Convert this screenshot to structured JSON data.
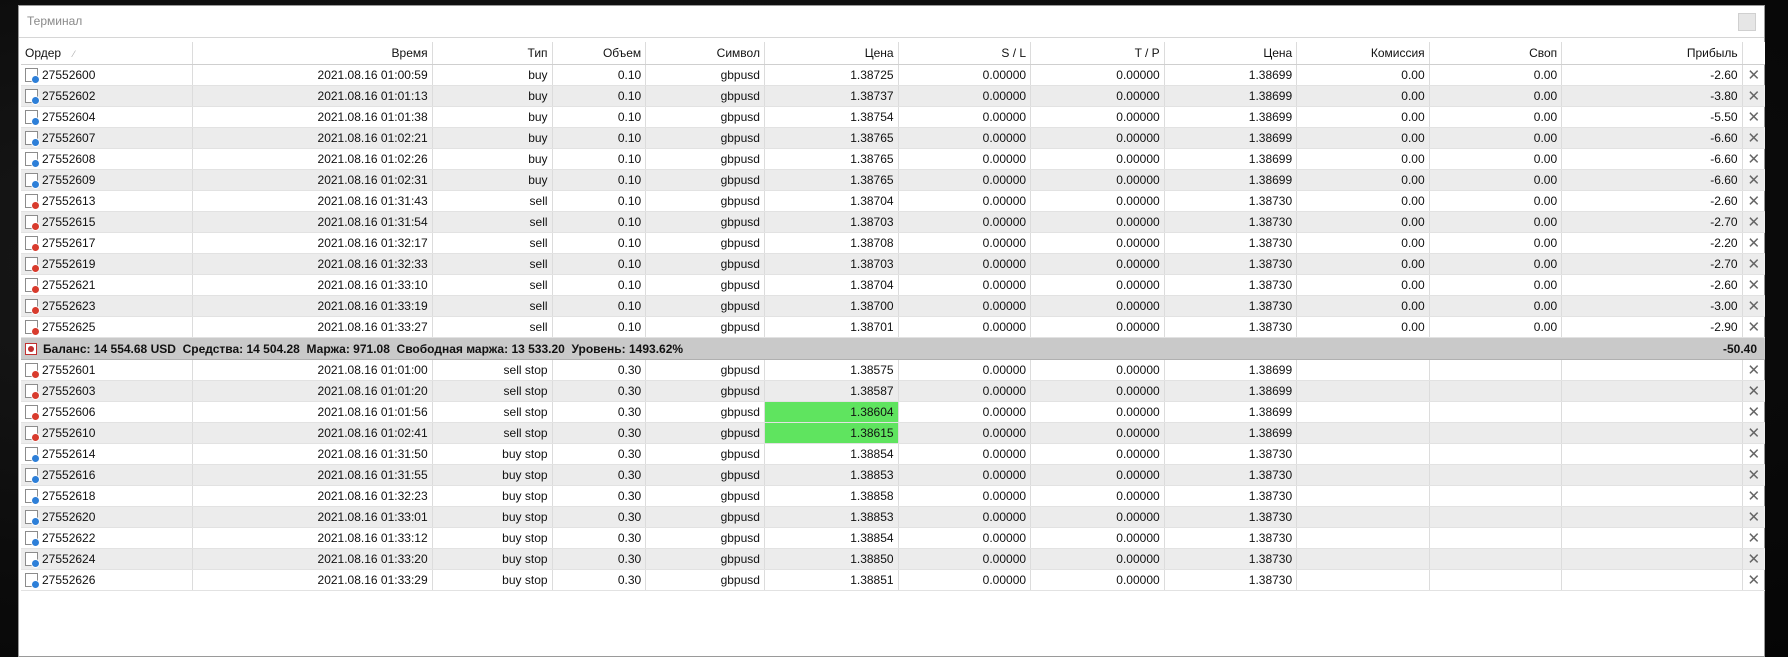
{
  "window": {
    "title": "Терминал"
  },
  "columns": [
    "Ордер",
    "Время",
    "Тип",
    "Объем",
    "Символ",
    "Цена",
    "S / L",
    "T / P",
    "Цена",
    "Комиссия",
    "Своп",
    "Прибыль"
  ],
  "sort_indicator": "⁄",
  "positions": [
    {
      "order": "27552600",
      "time": "2021.08.16 01:00:59",
      "type": "buy",
      "volume": "0.10",
      "symbol": "gbpusd",
      "price": "1.38725",
      "sl": "0.00000",
      "tp": "0.00000",
      "cur_price": "1.38699",
      "commission": "0.00",
      "swap": "0.00",
      "profit": "-2.60"
    },
    {
      "order": "27552602",
      "time": "2021.08.16 01:01:13",
      "type": "buy",
      "volume": "0.10",
      "symbol": "gbpusd",
      "price": "1.38737",
      "sl": "0.00000",
      "tp": "0.00000",
      "cur_price": "1.38699",
      "commission": "0.00",
      "swap": "0.00",
      "profit": "-3.80"
    },
    {
      "order": "27552604",
      "time": "2021.08.16 01:01:38",
      "type": "buy",
      "volume": "0.10",
      "symbol": "gbpusd",
      "price": "1.38754",
      "sl": "0.00000",
      "tp": "0.00000",
      "cur_price": "1.38699",
      "commission": "0.00",
      "swap": "0.00",
      "profit": "-5.50"
    },
    {
      "order": "27552607",
      "time": "2021.08.16 01:02:21",
      "type": "buy",
      "volume": "0.10",
      "symbol": "gbpusd",
      "price": "1.38765",
      "sl": "0.00000",
      "tp": "0.00000",
      "cur_price": "1.38699",
      "commission": "0.00",
      "swap": "0.00",
      "profit": "-6.60"
    },
    {
      "order": "27552608",
      "time": "2021.08.16 01:02:26",
      "type": "buy",
      "volume": "0.10",
      "symbol": "gbpusd",
      "price": "1.38765",
      "sl": "0.00000",
      "tp": "0.00000",
      "cur_price": "1.38699",
      "commission": "0.00",
      "swap": "0.00",
      "profit": "-6.60"
    },
    {
      "order": "27552609",
      "time": "2021.08.16 01:02:31",
      "type": "buy",
      "volume": "0.10",
      "symbol": "gbpusd",
      "price": "1.38765",
      "sl": "0.00000",
      "tp": "0.00000",
      "cur_price": "1.38699",
      "commission": "0.00",
      "swap": "0.00",
      "profit": "-6.60"
    },
    {
      "order": "27552613",
      "time": "2021.08.16 01:31:43",
      "type": "sell",
      "volume": "0.10",
      "symbol": "gbpusd",
      "price": "1.38704",
      "sl": "0.00000",
      "tp": "0.00000",
      "cur_price": "1.38730",
      "commission": "0.00",
      "swap": "0.00",
      "profit": "-2.60"
    },
    {
      "order": "27552615",
      "time": "2021.08.16 01:31:54",
      "type": "sell",
      "volume": "0.10",
      "symbol": "gbpusd",
      "price": "1.38703",
      "sl": "0.00000",
      "tp": "0.00000",
      "cur_price": "1.38730",
      "commission": "0.00",
      "swap": "0.00",
      "profit": "-2.70"
    },
    {
      "order": "27552617",
      "time": "2021.08.16 01:32:17",
      "type": "sell",
      "volume": "0.10",
      "symbol": "gbpusd",
      "price": "1.38708",
      "sl": "0.00000",
      "tp": "0.00000",
      "cur_price": "1.38730",
      "commission": "0.00",
      "swap": "0.00",
      "profit": "-2.20"
    },
    {
      "order": "27552619",
      "time": "2021.08.16 01:32:33",
      "type": "sell",
      "volume": "0.10",
      "symbol": "gbpusd",
      "price": "1.38703",
      "sl": "0.00000",
      "tp": "0.00000",
      "cur_price": "1.38730",
      "commission": "0.00",
      "swap": "0.00",
      "profit": "-2.70"
    },
    {
      "order": "27552621",
      "time": "2021.08.16 01:33:10",
      "type": "sell",
      "volume": "0.10",
      "symbol": "gbpusd",
      "price": "1.38704",
      "sl": "0.00000",
      "tp": "0.00000",
      "cur_price": "1.38730",
      "commission": "0.00",
      "swap": "0.00",
      "profit": "-2.60"
    },
    {
      "order": "27552623",
      "time": "2021.08.16 01:33:19",
      "type": "sell",
      "volume": "0.10",
      "symbol": "gbpusd",
      "price": "1.38700",
      "sl": "0.00000",
      "tp": "0.00000",
      "cur_price": "1.38730",
      "commission": "0.00",
      "swap": "0.00",
      "profit": "-3.00"
    },
    {
      "order": "27552625",
      "time": "2021.08.16 01:33:27",
      "type": "sell",
      "volume": "0.10",
      "symbol": "gbpusd",
      "price": "1.38701",
      "sl": "0.00000",
      "tp": "0.00000",
      "cur_price": "1.38730",
      "commission": "0.00",
      "swap": "0.00",
      "profit": "-2.90"
    }
  ],
  "summary": {
    "text": "Баланс: 14 554.68 USD  Средства: 14 504.28  Маржа: 971.08  Свободная маржа: 13 533.20  Уровень: 1493.62%",
    "total_profit": "-50.40"
  },
  "pending_orders": [
    {
      "order": "27552601",
      "time": "2021.08.16 01:01:00",
      "type": "sell stop",
      "volume": "0.30",
      "symbol": "gbpusd",
      "price": "1.38575",
      "sl": "0.00000",
      "tp": "0.00000",
      "cur_price": "1.38699",
      "highlight": false
    },
    {
      "order": "27552603",
      "time": "2021.08.16 01:01:20",
      "type": "sell stop",
      "volume": "0.30",
      "symbol": "gbpusd",
      "price": "1.38587",
      "sl": "0.00000",
      "tp": "0.00000",
      "cur_price": "1.38699",
      "highlight": false
    },
    {
      "order": "27552606",
      "time": "2021.08.16 01:01:56",
      "type": "sell stop",
      "volume": "0.30",
      "symbol": "gbpusd",
      "price": "1.38604",
      "sl": "0.00000",
      "tp": "0.00000",
      "cur_price": "1.38699",
      "highlight": true
    },
    {
      "order": "27552610",
      "time": "2021.08.16 01:02:41",
      "type": "sell stop",
      "volume": "0.30",
      "symbol": "gbpusd",
      "price": "1.38615",
      "sl": "0.00000",
      "tp": "0.00000",
      "cur_price": "1.38699",
      "highlight": true
    },
    {
      "order": "27552614",
      "time": "2021.08.16 01:31:50",
      "type": "buy stop",
      "volume": "0.30",
      "symbol": "gbpusd",
      "price": "1.38854",
      "sl": "0.00000",
      "tp": "0.00000",
      "cur_price": "1.38730",
      "highlight": false
    },
    {
      "order": "27552616",
      "time": "2021.08.16 01:31:55",
      "type": "buy stop",
      "volume": "0.30",
      "symbol": "gbpusd",
      "price": "1.38853",
      "sl": "0.00000",
      "tp": "0.00000",
      "cur_price": "1.38730",
      "highlight": false
    },
    {
      "order": "27552618",
      "time": "2021.08.16 01:32:23",
      "type": "buy stop",
      "volume": "0.30",
      "symbol": "gbpusd",
      "price": "1.38858",
      "sl": "0.00000",
      "tp": "0.00000",
      "cur_price": "1.38730",
      "highlight": false
    },
    {
      "order": "27552620",
      "time": "2021.08.16 01:33:01",
      "type": "buy stop",
      "volume": "0.30",
      "symbol": "gbpusd",
      "price": "1.38853",
      "sl": "0.00000",
      "tp": "0.00000",
      "cur_price": "1.38730",
      "highlight": false
    },
    {
      "order": "27552622",
      "time": "2021.08.16 01:33:12",
      "type": "buy stop",
      "volume": "0.30",
      "symbol": "gbpusd",
      "price": "1.38854",
      "sl": "0.00000",
      "tp": "0.00000",
      "cur_price": "1.38730",
      "highlight": false
    },
    {
      "order": "27552624",
      "time": "2021.08.16 01:33:20",
      "type": "buy stop",
      "volume": "0.30",
      "symbol": "gbpusd",
      "price": "1.38850",
      "sl": "0.00000",
      "tp": "0.00000",
      "cur_price": "1.38730",
      "highlight": false
    },
    {
      "order": "27552626",
      "time": "2021.08.16 01:33:29",
      "type": "buy stop",
      "volume": "0.30",
      "symbol": "gbpusd",
      "price": "1.38851",
      "sl": "0.00000",
      "tp": "0.00000",
      "cur_price": "1.38730",
      "highlight": false
    }
  ],
  "icons": {
    "close": "close-icon",
    "buy": "buy-order-icon",
    "sell": "sell-order-icon"
  },
  "colors": {
    "highlight": "#5fe45f",
    "alt_row": "#ececec",
    "summary_bg": "#c9c9c9",
    "buy_icon": "#2d7fd8",
    "sell_icon": "#d83b2d"
  },
  "close_glyph": "✕"
}
